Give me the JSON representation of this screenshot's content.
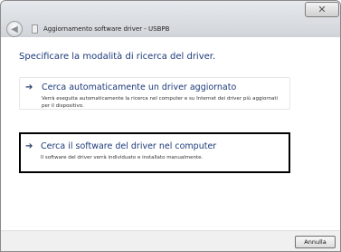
{
  "window": {
    "title": "Aggiornamento software driver - USBPB",
    "close_glyph": "✕",
    "back_glyph": "◀"
  },
  "main": {
    "heading": "Specificare la modalità di ricerca del driver.",
    "options": [
      {
        "arrow": "➔",
        "title": "Cerca automaticamente un driver aggiornato",
        "description": "Verrà eseguita automaticamente la ricerca nel computer e su Internet dei driver più aggiornati per il dispositivo."
      },
      {
        "arrow": "➔",
        "title": "Cerca il software del driver nel computer",
        "description": "Il software del driver verrà individuato e installato manualmente."
      }
    ]
  },
  "footer": {
    "cancel_label": "Annulla"
  },
  "icons": {
    "back": "back-arrow-icon",
    "app": "device-icon",
    "close": "close-icon",
    "option_arrow": "right-arrow-icon"
  }
}
